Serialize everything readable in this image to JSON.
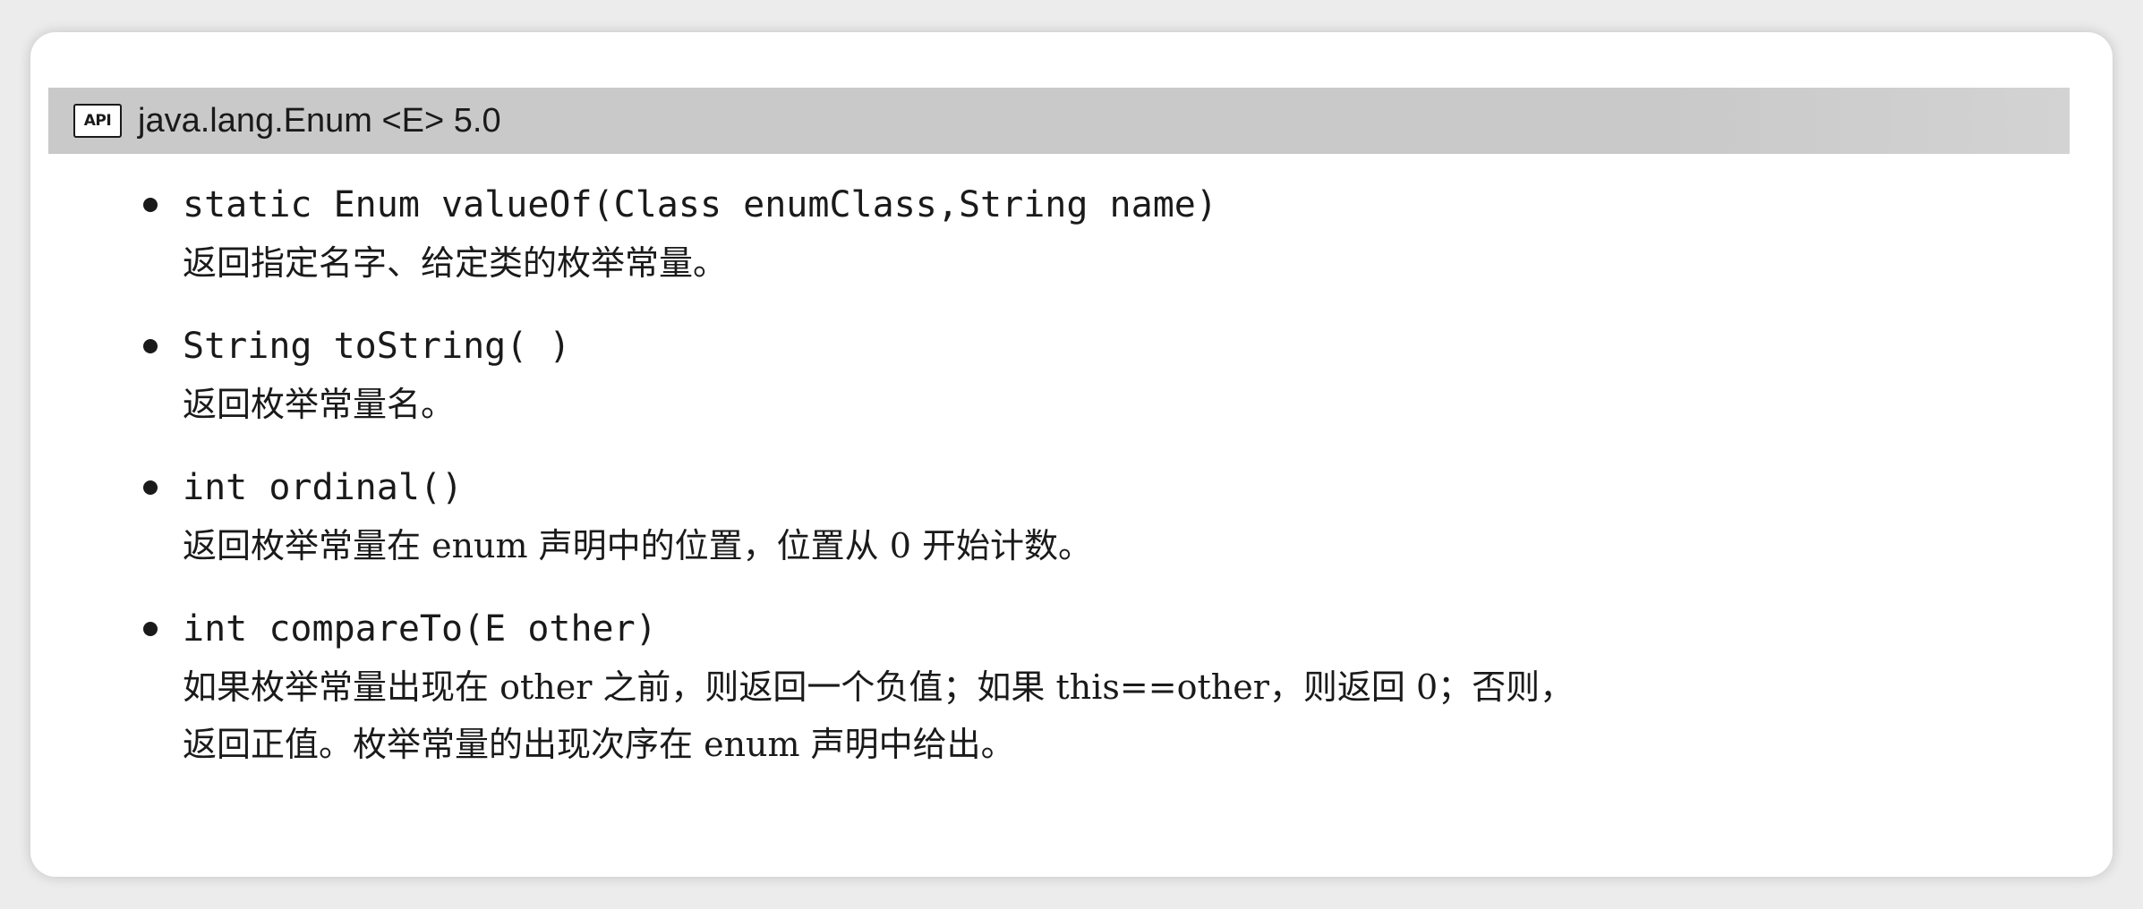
{
  "header": {
    "badge": "API",
    "title": "java.lang.Enum <E> 5.0"
  },
  "entries": [
    {
      "signature": "static Enum valueOf(Class enumClass,String name)",
      "desc_lines": [
        "返回指定名字、给定类的枚举常量。"
      ]
    },
    {
      "signature": "String toString( )",
      "desc_lines": [
        "返回枚举常量名。"
      ]
    },
    {
      "signature": "int ordinal()",
      "desc_lines": [
        "返回枚举常量在 enum 声明中的位置，位置从 0 开始计数。"
      ]
    },
    {
      "signature": "int compareTo(E other)",
      "desc_lines": [
        "如果枚举常量出现在 other 之前，则返回一个负值；如果 this==other，则返回 0；否则，",
        "返回正值。枚举常量的出现次序在 enum 声明中给出。"
      ]
    }
  ]
}
